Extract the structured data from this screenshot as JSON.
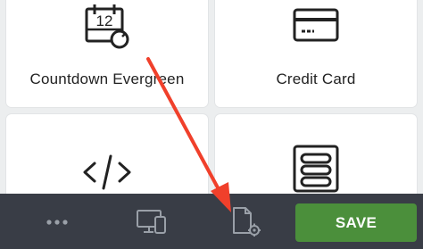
{
  "widgets": [
    {
      "label": "Countdown Evergreen",
      "icon": "countdown-calendar-icon"
    },
    {
      "label": "Credit Card",
      "icon": "credit-card-icon"
    },
    {
      "label": "",
      "icon": "code-icon"
    },
    {
      "label": "",
      "icon": "list-form-icon"
    }
  ],
  "countdown_icon_number": "12",
  "bottom_bar": {
    "more_icon": "ellipsis-icon",
    "devices_icon": "devices-icon",
    "page_settings_icon": "file-settings-icon",
    "save_label": "SAVE"
  },
  "colors": {
    "bottom_bar": "#393d46",
    "save_button": "#4b8f3b",
    "annotation_arrow": "#f0402b"
  }
}
